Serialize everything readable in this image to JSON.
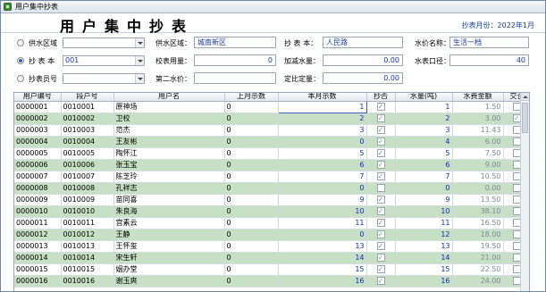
{
  "window_title": "用户集中抄表",
  "page_title": "用户集中抄表",
  "month": "抄表月份：2022年1月",
  "filters": {
    "water_area_label": "供水区域",
    "meter_label": "抄 表 本",
    "meter_value": "001",
    "reader_label": "抄表员号",
    "area_label": "供水区域：",
    "area_value": "城南新区",
    "book_label": "抄 表 本：",
    "book_value": "人民路",
    "price_label": "水价名称：",
    "price_value": "生活一档",
    "usage_label": "校表用量：",
    "usage_value": "0",
    "surcharge_label": "加减水量：",
    "surcharge_value": "0.00",
    "caliber_label": "水表口径：",
    "caliber_value": "40",
    "second_label": "第二水价：",
    "second_value": "",
    "fixed_label": "定比定量：",
    "fixed_value": "0.00"
  },
  "columns": [
    "用户编号",
    "段户号",
    "用户名",
    "上月示数",
    "本月示数",
    "抄否",
    "水量(吨)",
    "水费金额",
    "交否"
  ],
  "rows": [
    {
      "id": "0000001",
      "seg": "0010001",
      "name": "原神场",
      "last": "0",
      "cur": "1",
      "read": true,
      "water": "1",
      "fee": "1.50",
      "paid": false
    },
    {
      "id": "0000002",
      "seg": "0010002",
      "name": "卫校",
      "last": "0",
      "cur": "2",
      "read": true,
      "water": "2",
      "fee": "3.00",
      "paid": true
    },
    {
      "id": "0000003",
      "seg": "0010003",
      "name": "范杰",
      "last": "0",
      "cur": "3",
      "read": true,
      "water": "3",
      "fee": "11.43",
      "paid": false
    },
    {
      "id": "0000004",
      "seg": "0010004",
      "name": "王友彬",
      "last": "0",
      "cur": "0",
      "read": true,
      "water": "4",
      "fee": "6.00",
      "paid": false
    },
    {
      "id": "0000005",
      "seg": "0010005",
      "name": "陶怀江",
      "last": "0",
      "cur": "5",
      "read": true,
      "water": "5",
      "fee": "7.50",
      "paid": false
    },
    {
      "id": "0000006",
      "seg": "0010006",
      "name": "张玉宝",
      "last": "0",
      "cur": "6",
      "read": true,
      "water": "6",
      "fee": "9.00",
      "paid": false
    },
    {
      "id": "0000007",
      "seg": "0010007",
      "name": "陈芝玲",
      "last": "0",
      "cur": "7",
      "read": true,
      "water": "7",
      "fee": "10.50",
      "paid": false
    },
    {
      "id": "0000008",
      "seg": "0010008",
      "name": "孔祥志",
      "last": "0",
      "cur": "0",
      "read": false,
      "water": "0",
      "fee": "0.00",
      "paid": false
    },
    {
      "id": "0000009",
      "seg": "0010009",
      "name": "苗同喜",
      "last": "0",
      "cur": "9",
      "read": true,
      "water": "9",
      "fee": "13.50",
      "paid": false
    },
    {
      "id": "0000010",
      "seg": "0010010",
      "name": "朱良海",
      "last": "0",
      "cur": "10",
      "read": true,
      "water": "10",
      "fee": "38.10",
      "paid": false
    },
    {
      "id": "0000011",
      "seg": "0010011",
      "name": "宫素云",
      "last": "0",
      "cur": "11",
      "read": true,
      "water": "11",
      "fee": "16.50",
      "paid": false
    },
    {
      "id": "0000012",
      "seg": "0010012",
      "name": "王静",
      "last": "0",
      "cur": "0",
      "read": true,
      "water": "12",
      "fee": "18.00",
      "paid": false
    },
    {
      "id": "0000013",
      "seg": "0010013",
      "name": "王怀玺",
      "last": "0",
      "cur": "13",
      "read": true,
      "water": "13",
      "fee": "19.50",
      "paid": false
    },
    {
      "id": "0000014",
      "seg": "0010014",
      "name": "宋生轩",
      "last": "0",
      "cur": "14",
      "read": true,
      "water": "14",
      "fee": "21.00",
      "paid": false
    },
    {
      "id": "0000015",
      "seg": "0010015",
      "name": "姻办堂",
      "last": "0",
      "cur": "15",
      "read": true,
      "water": "15",
      "fee": "22.50",
      "paid": false
    },
    {
      "id": "0000016",
      "seg": "0010016",
      "name": "谢玉爽",
      "last": "0",
      "cur": "16",
      "read": true,
      "water": "16",
      "fee": "24.00",
      "paid": false
    }
  ]
}
